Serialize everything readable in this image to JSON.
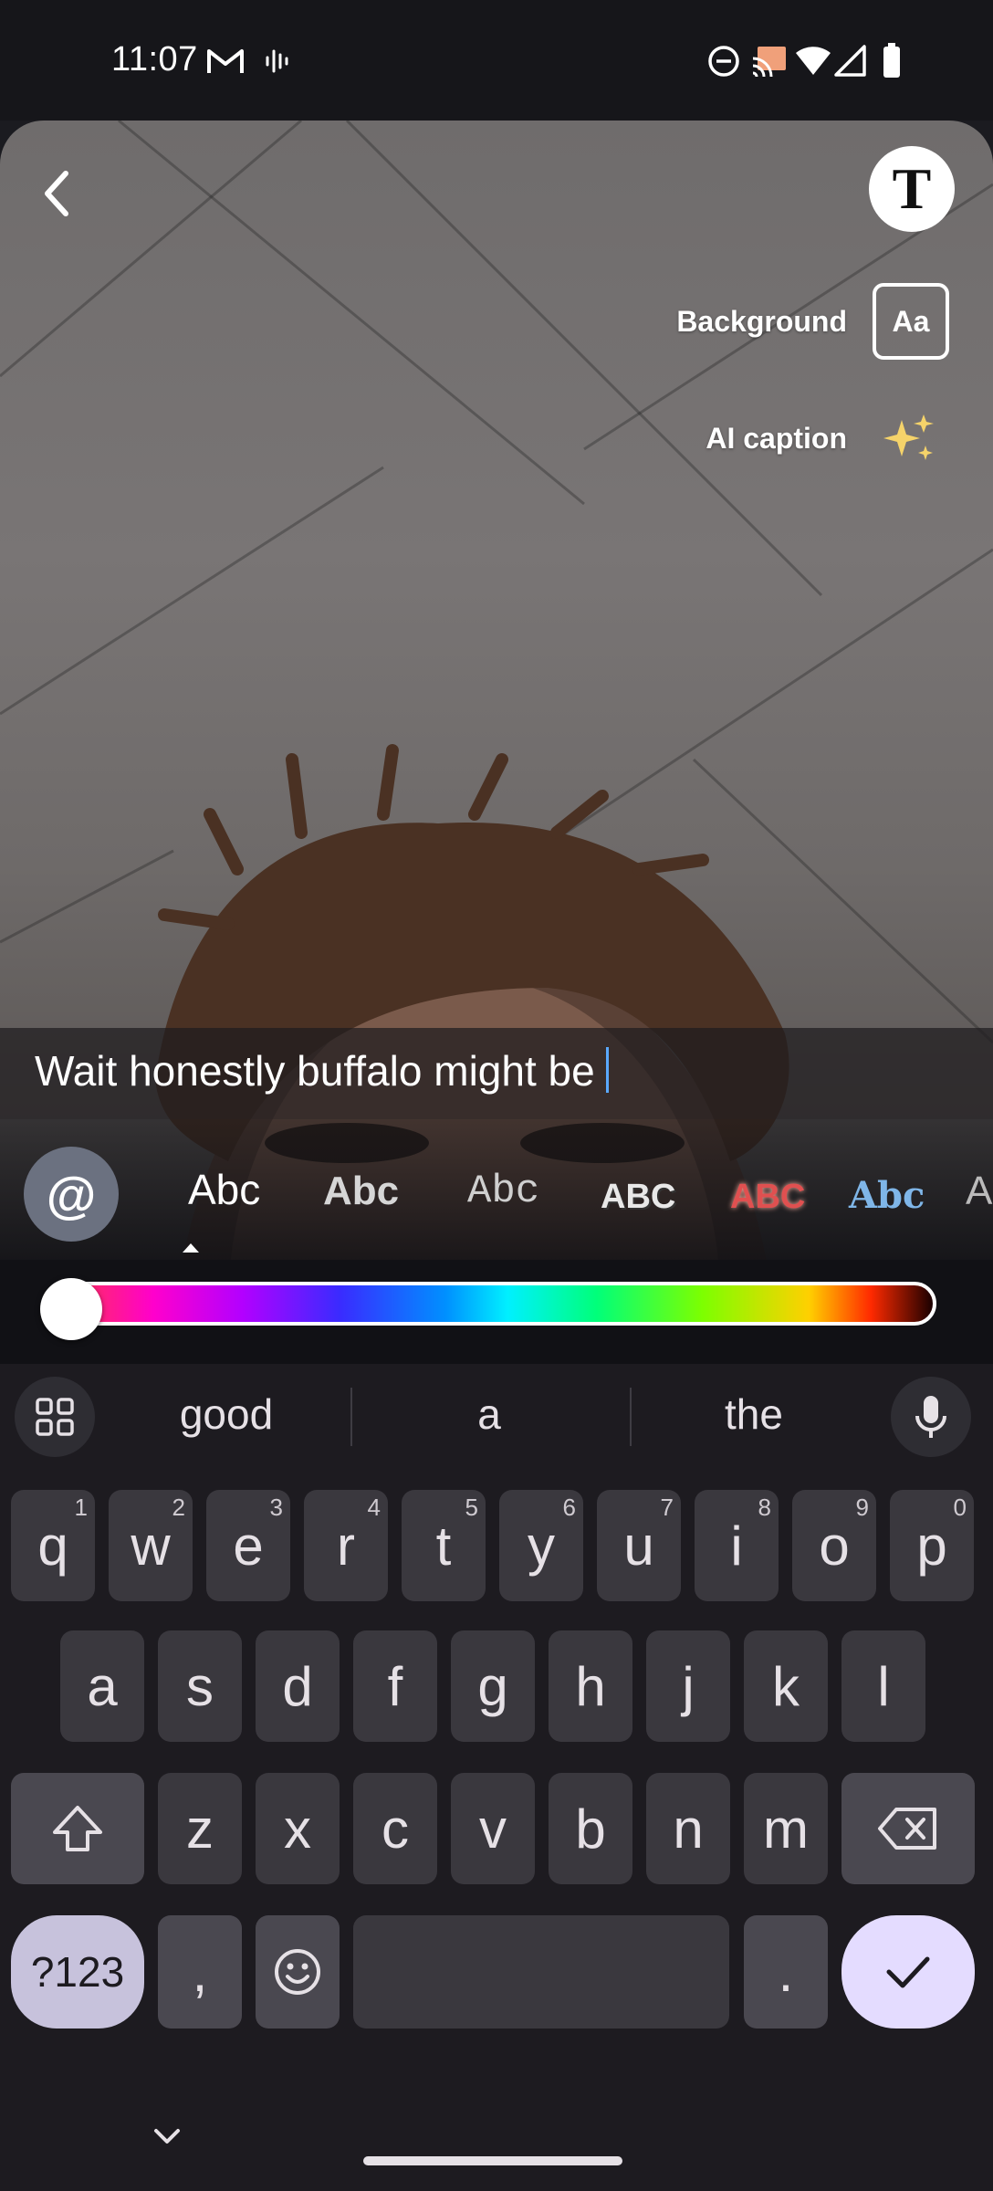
{
  "status_bar": {
    "time": "11:07",
    "icons": [
      "gmail-icon",
      "voice-recorder-icon",
      "do-not-disturb-icon",
      "cast-icon",
      "wifi-icon",
      "cell-signal-icon",
      "battery-icon"
    ]
  },
  "editor": {
    "background_label": "Background",
    "background_button": "Aa",
    "ai_caption_label": "AI caption",
    "text_tool_glyph": "T",
    "caption_text": "Wait honestly buffalo might be",
    "mention_button": "@",
    "font_options": [
      "Abc",
      "Abc",
      "Abc",
      "ABC",
      "ABC",
      "Abc",
      "A"
    ],
    "color_slider_value": 0
  },
  "keyboard": {
    "suggestions": [
      "good",
      "a",
      "the"
    ],
    "row1": [
      {
        "k": "q",
        "h": "1"
      },
      {
        "k": "w",
        "h": "2"
      },
      {
        "k": "e",
        "h": "3"
      },
      {
        "k": "r",
        "h": "4"
      },
      {
        "k": "t",
        "h": "5"
      },
      {
        "k": "y",
        "h": "6"
      },
      {
        "k": "u",
        "h": "7"
      },
      {
        "k": "i",
        "h": "8"
      },
      {
        "k": "o",
        "h": "9"
      },
      {
        "k": "p",
        "h": "0"
      }
    ],
    "row2": [
      "a",
      "s",
      "d",
      "f",
      "g",
      "h",
      "j",
      "k",
      "l"
    ],
    "row3": [
      "z",
      "x",
      "c",
      "v",
      "b",
      "n",
      "m"
    ],
    "symbols_key": "?123",
    "comma_key": ",",
    "period_key": "."
  },
  "colors": {
    "keyboard_bg": "#1d1b20",
    "key_bg": "#3a383e",
    "accent_done": "#e4dcff",
    "cursor": "#5aa9ff"
  }
}
